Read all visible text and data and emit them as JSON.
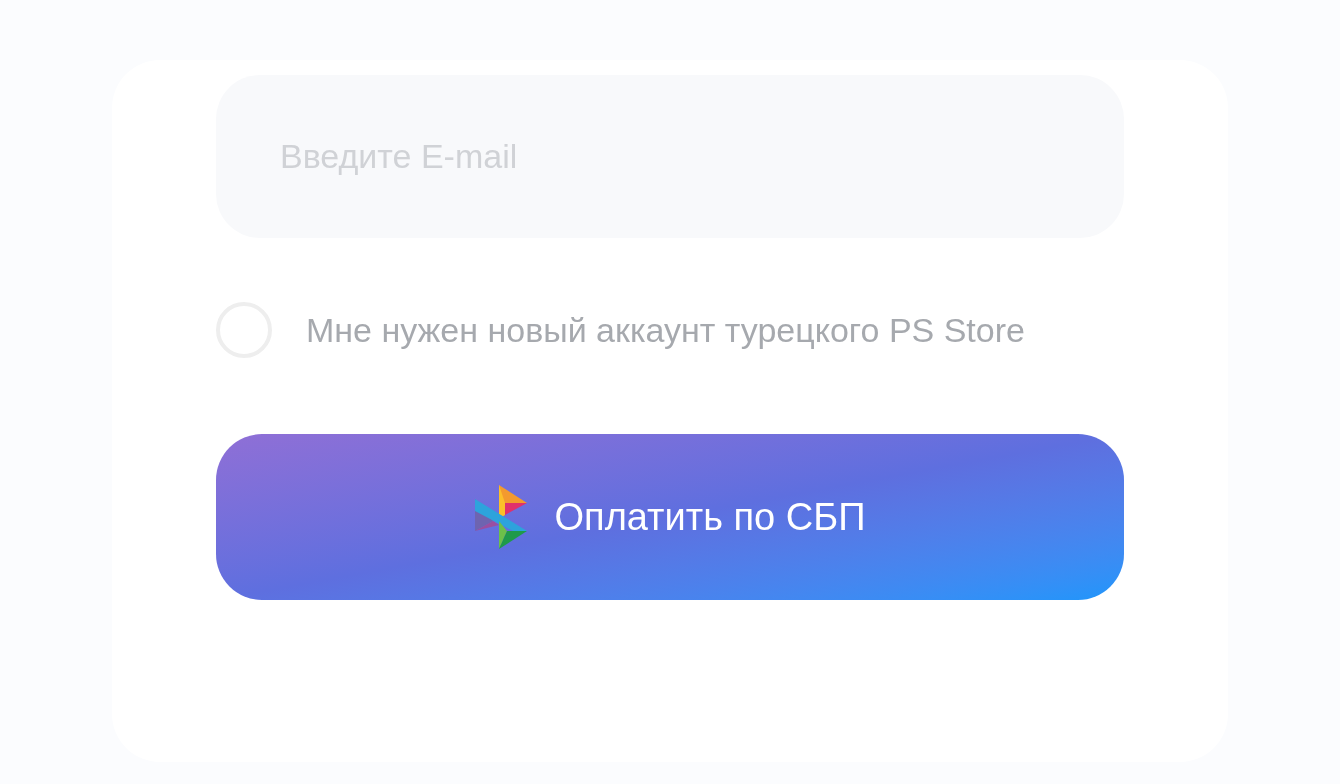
{
  "email_field": {
    "placeholder": "Введите E-mail"
  },
  "new_account_option": {
    "label": "Мне нужен новый аккаунт турецкого PS Store",
    "checked": false
  },
  "pay_button": {
    "label": "Оплатить по СБП"
  }
}
